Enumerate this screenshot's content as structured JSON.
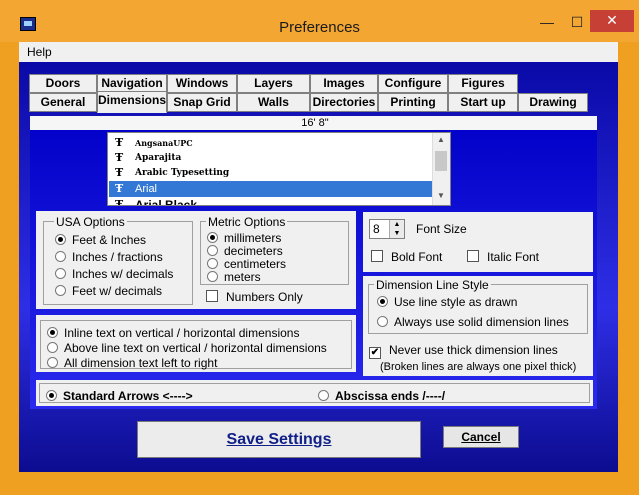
{
  "window": {
    "title": "Preferences",
    "min_glyph": "—",
    "max_glyph": "☐",
    "close_glyph": "✕"
  },
  "menu": {
    "help": "Help"
  },
  "tabs_row1": [
    "Doors",
    "Navigation",
    "Windows",
    "Layers",
    "Images",
    "Configure",
    "Figures"
  ],
  "tabs_row2": [
    "General",
    "Dimensions",
    "Snap Grid",
    "Walls",
    "Directories",
    "Printing",
    "Start up",
    "Drawing"
  ],
  "selected_tab": "Dimensions",
  "length_label": "16' 8\"",
  "font_list": {
    "items": [
      "AngsanaUPC",
      "Aparajita",
      "Arabic Typesetting",
      "Arial",
      "Arial Black"
    ],
    "selected": "Arial",
    "icon_glyph": "Ŧ"
  },
  "usa_options": {
    "title": "USA Options",
    "items": [
      "Feet & Inches",
      "Inches / fractions",
      "Inches w/ decimals",
      "Feet w/ decimals"
    ],
    "selected_index": 0
  },
  "metric_options": {
    "title": "Metric Options",
    "items": [
      "millimeters",
      "decimeters",
      "centimeters",
      "meters"
    ],
    "selected_index": 0,
    "numbers_only": "Numbers Only"
  },
  "font": {
    "size_value": "8",
    "size_label": "Font Size",
    "bold": "Bold Font",
    "italic": "Italic Font"
  },
  "dimension_line_style": {
    "title": "Dimension Line Style",
    "items": [
      "Use line style as drawn",
      "Always use solid dimension lines"
    ],
    "selected_index": 0
  },
  "thick_lines": {
    "label": "Never use thick dimension lines",
    "checked": true,
    "note": "(Broken lines are always one pixel thick)"
  },
  "text_placement": {
    "items": [
      "Inline text on vertical / horizontal dimensions",
      "Above line text on vertical / horizontal dimensions",
      "All dimension text left to right"
    ],
    "selected_index": 0
  },
  "arrows": {
    "standard": "Standard Arrows <---->",
    "abscissa": "Abscissa ends   /----/",
    "selected": "standard"
  },
  "buttons": {
    "save": "Save Settings",
    "cancel": "Cancel"
  },
  "check_glyph": "✔"
}
